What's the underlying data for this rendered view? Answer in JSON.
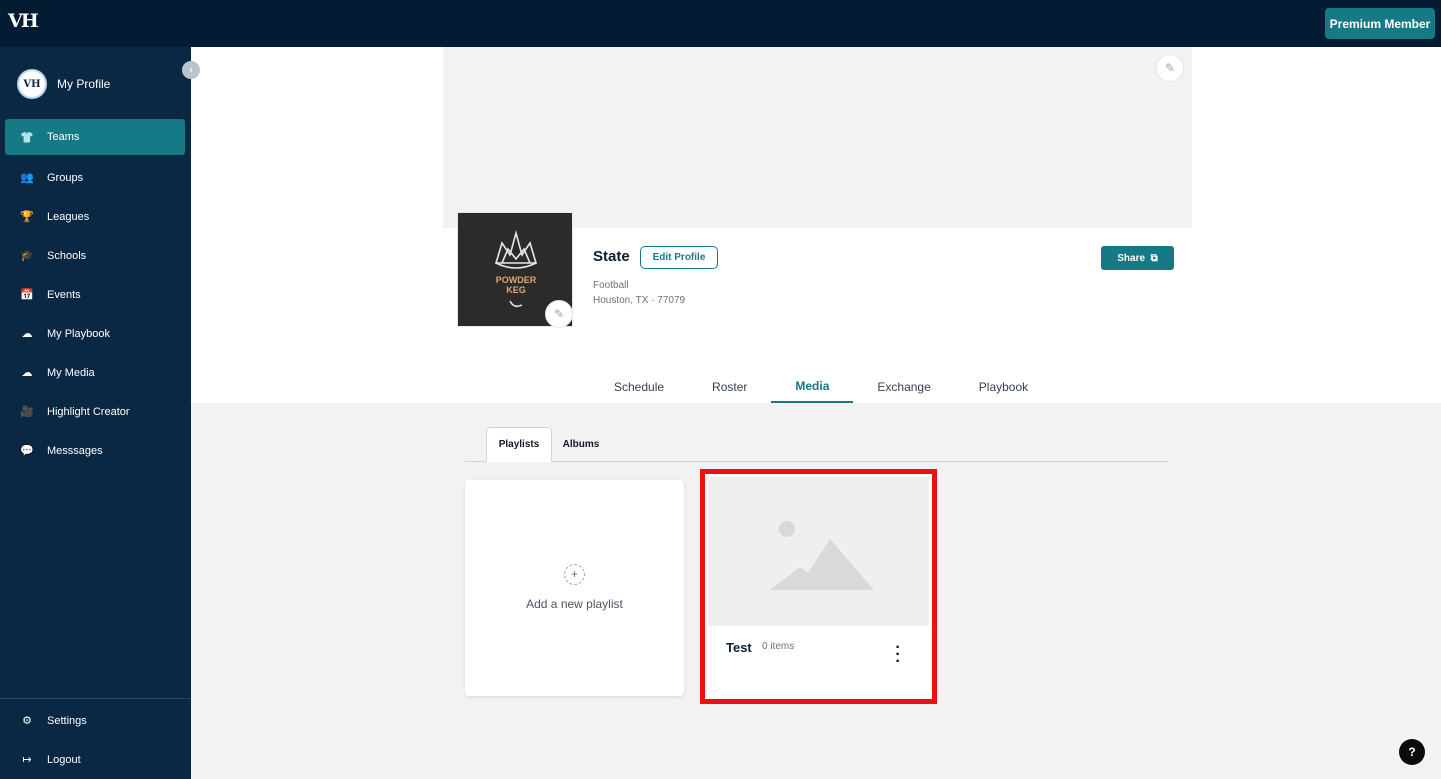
{
  "topbar": {
    "brand": "VH",
    "premium_label": "Premium Member"
  },
  "sidebar": {
    "profile": {
      "avatar_text": "VH",
      "label": "My Profile"
    },
    "collapse_icon": "chevron-left-icon",
    "items": [
      {
        "label": "Teams",
        "icon": "shirt-icon",
        "glyph": "👕",
        "active": true
      },
      {
        "label": "Groups",
        "icon": "users-icon",
        "glyph": "👥"
      },
      {
        "label": "Leagues",
        "icon": "trophy-icon",
        "glyph": "🏆"
      },
      {
        "label": "Schools",
        "icon": "graduation-cap-icon",
        "glyph": "🎓"
      },
      {
        "label": "Events",
        "icon": "calendar-icon",
        "glyph": "📅"
      },
      {
        "label": "My Playbook",
        "icon": "cloud-upload-icon",
        "glyph": "☁"
      },
      {
        "label": "My Media",
        "icon": "cloud-upload-icon",
        "glyph": "☁"
      },
      {
        "label": "Highlight Creator",
        "icon": "video-camera-icon",
        "glyph": "🎥"
      },
      {
        "label": "Messsages",
        "icon": "chat-icon",
        "glyph": "💬"
      }
    ],
    "bottom": [
      {
        "label": "Settings",
        "icon": "gear-icon",
        "glyph": "⚙"
      },
      {
        "label": "Logout",
        "icon": "logout-icon",
        "glyph": "↦"
      }
    ]
  },
  "team": {
    "name": "State",
    "edit_profile_label": "Edit Profile",
    "sport": "Football",
    "location": "Houston, TX · 77079",
    "share_label": "Share",
    "logo_text_line1": "POWDER",
    "logo_text_line2": "KEG"
  },
  "tabs": [
    {
      "label": "Schedule"
    },
    {
      "label": "Roster"
    },
    {
      "label": "Media",
      "active": true
    },
    {
      "label": "Exchange"
    },
    {
      "label": "Playbook"
    }
  ],
  "subtabs": {
    "playlists": "Playlists",
    "albums": "Albums"
  },
  "add_playlist": {
    "plus": "+",
    "label": "Add a new playlist"
  },
  "playlist": {
    "title": "Test",
    "count": "0 items"
  },
  "help": "?",
  "colors": {
    "topbar": "#041c33",
    "sidebar": "#0a2743",
    "accent": "#157a85",
    "highlight_border": "#ee1111"
  }
}
